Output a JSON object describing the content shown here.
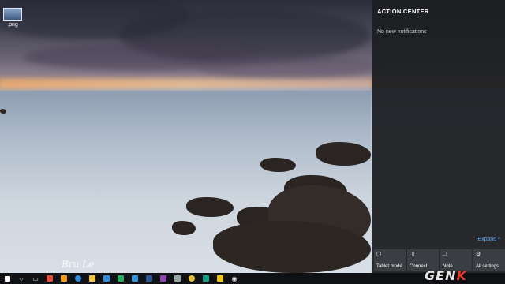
{
  "desktop": {
    "icon_label": ".png",
    "signature": "Bru Le"
  },
  "action_center": {
    "title": "ACTION CENTER",
    "empty_message": "No new notifications",
    "expand_label": "Expand",
    "tiles": [
      {
        "label": "Tablet mode",
        "icon": "tablet-mode-icon"
      },
      {
        "label": "Connect",
        "icon": "connect-icon"
      },
      {
        "label": "Note",
        "icon": "note-icon"
      },
      {
        "label": "All settings",
        "icon": "settings-icon"
      }
    ]
  },
  "watermark": {
    "text_main": "GEN",
    "text_accent": "K"
  },
  "taskbar": {
    "items": [
      {
        "icon": "start-windows-icon",
        "color": "#ffffff"
      },
      {
        "icon": "search-icon",
        "color": "#ffffff"
      },
      {
        "icon": "task-view-icon",
        "color": "#ffffff"
      },
      {
        "icon": "app-red-icon",
        "color": "#e74c3c"
      },
      {
        "icon": "app-orange-icon",
        "color": "#f39c12"
      },
      {
        "icon": "edge-browser-icon",
        "color": "#2f8ee0"
      },
      {
        "icon": "file-explorer-icon",
        "color": "#f5c542"
      },
      {
        "icon": "store-icon",
        "color": "#2f8ee0"
      },
      {
        "icon": "app-green-icon",
        "color": "#27ae60"
      },
      {
        "icon": "app-blue-icon",
        "color": "#3498db"
      },
      {
        "icon": "word-icon",
        "color": "#2b5797"
      },
      {
        "icon": "app-purple-icon",
        "color": "#8e44ad"
      },
      {
        "icon": "app-gray-icon",
        "color": "#95a5a6"
      },
      {
        "icon": "chrome-icon",
        "color": "#e8c13a"
      },
      {
        "icon": "app-teal-icon",
        "color": "#16a085"
      },
      {
        "icon": "app-yellow-icon",
        "color": "#f1c40f"
      },
      {
        "icon": "media-icon",
        "color": "#ffffff"
      }
    ]
  }
}
